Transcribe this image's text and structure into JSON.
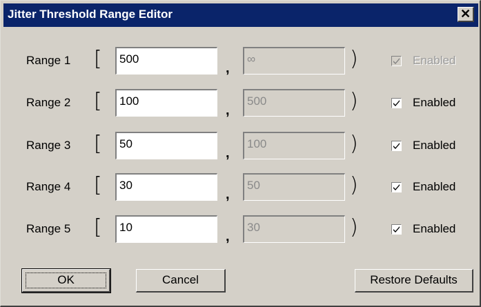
{
  "window": {
    "title": "Jitter Threshold Range Editor",
    "close_glyph": "✕"
  },
  "ranges": [
    {
      "label": "Range 1",
      "low": "500",
      "high": "∞",
      "enabled_label": "Enabled",
      "checked": true,
      "enabled": false
    },
    {
      "label": "Range 2",
      "low": "100",
      "high": "500",
      "enabled_label": "Enabled",
      "checked": true,
      "enabled": true
    },
    {
      "label": "Range 3",
      "low": "50",
      "high": "100",
      "enabled_label": "Enabled",
      "checked": true,
      "enabled": true
    },
    {
      "label": "Range 4",
      "low": "30",
      "high": "50",
      "enabled_label": "Enabled",
      "checked": true,
      "enabled": true
    },
    {
      "label": "Range 5",
      "low": "10",
      "high": "30",
      "enabled_label": "Enabled",
      "checked": true,
      "enabled": true
    }
  ],
  "symbols": {
    "open_bracket": "[",
    "close_bracket": ")",
    "comma": ","
  },
  "buttons": {
    "ok": "OK",
    "cancel": "Cancel",
    "restore": "Restore Defaults"
  }
}
